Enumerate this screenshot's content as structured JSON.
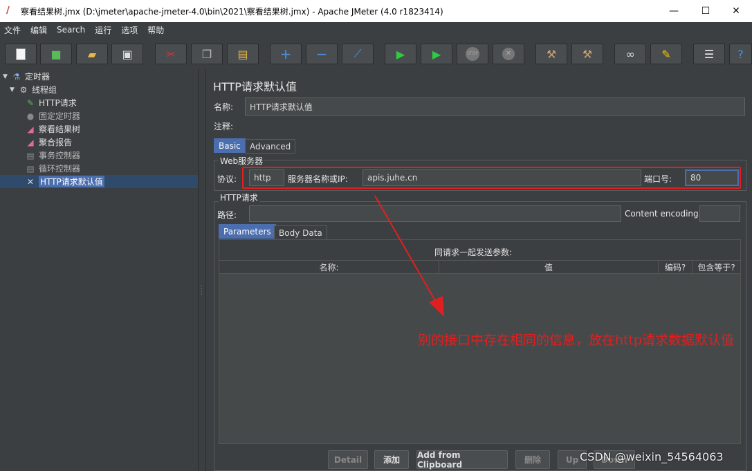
{
  "window": {
    "title": "察看结果树.jmx (D:\\jmeter\\apache-jmeter-4.0\\bin\\2021\\察看结果树.jmx) - Apache JMeter (4.0 r1823414)",
    "minimize": "—",
    "maximize": "☐",
    "close": "✕"
  },
  "menu": [
    "文件",
    "编辑",
    "Search",
    "运行",
    "选项",
    "帮助"
  ],
  "toolbar": {
    "icons": [
      "new-icon",
      "templates-icon",
      "open-icon",
      "save-icon",
      "cut-icon",
      "copy-icon",
      "paste-icon",
      "expand-icon",
      "collapse-icon",
      "toggle-icon",
      "start-icon",
      "start-no-pause-icon",
      "stop-icon",
      "shutdown-icon",
      "clear-icon",
      "clear-all-icon",
      "search-icon",
      "reset-search-icon",
      "function-helper-icon",
      "help-icon"
    ]
  },
  "tree": {
    "items": [
      {
        "label": "定时器",
        "icon": "test-plan-icon"
      },
      {
        "label": "线程组",
        "icon": "thread-group-icon"
      },
      {
        "label": "HTTP请求",
        "icon": "sampler-icon"
      },
      {
        "label": "固定定时器",
        "icon": "timer-icon"
      },
      {
        "label": "察看结果树",
        "icon": "listener-icon"
      },
      {
        "label": "聚合报告",
        "icon": "listener-icon"
      },
      {
        "label": "事务控制器",
        "icon": "controller-icon"
      },
      {
        "label": "循环控制器",
        "icon": "controller-icon"
      },
      {
        "label": "HTTP请求默认值",
        "icon": "config-icon"
      }
    ]
  },
  "panel": {
    "title": "HTTP请求默认值",
    "name_label": "名称:",
    "name_value": "HTTP请求默认值",
    "comment_label": "注释:",
    "tabs": [
      "Basic",
      "Advanced"
    ],
    "web_server_group": "Web服务器",
    "protocol_label": "协议:",
    "protocol_value": "http",
    "server_label": "服务器名称或IP:",
    "server_value": "apis.juhe.cn",
    "port_label": "端口号:",
    "port_value": "80",
    "http_request_group": "HTTP请求",
    "path_label": "路径:",
    "encoding_label": "Content encoding:",
    "sub_tabs": [
      "Parameters",
      "Body Data"
    ],
    "params_caption": "同请求一起发送参数:",
    "columns": [
      "名称:",
      "值",
      "编码?",
      "包含等于?"
    ],
    "buttons": [
      "Detail",
      "添加",
      "Add from Clipboard",
      "删除",
      "Up",
      "Down"
    ]
  },
  "annotation": {
    "text": "别的接口中存在相同的信息，放在http请求数据默认值",
    "color": "#e02020"
  },
  "watermark": "CSDN @weixin_54564063"
}
